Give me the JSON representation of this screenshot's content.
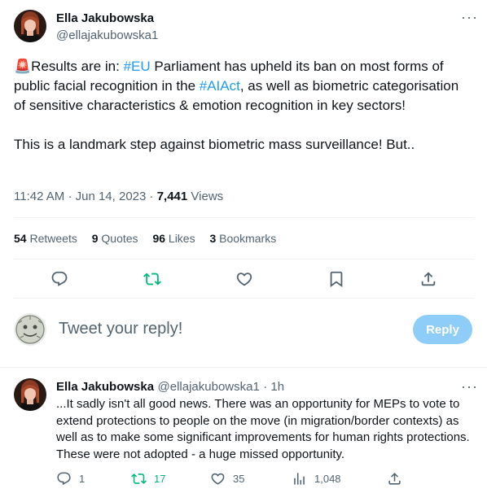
{
  "tweet": {
    "author_name": "Ella Jakubowska",
    "author_handle": "@ellajakubowska1",
    "text_parts": {
      "emoji": "🚨",
      "t1": "Results are in: ",
      "hashtag1": "#EU",
      "t2": " Parliament has upheld its ban on most forms of public facial recognition in the ",
      "hashtag2": "#AIAct",
      "t3": ", as well as biometric categorisation of sensitive characteristics & emotion recognition in key sectors!",
      "t4": "This is a landmark step against biometric mass surveillance! But.."
    },
    "time": "11:42 AM",
    "date": "Jun 14, 2023",
    "separator": "·",
    "views_count": "7,441",
    "views_label": "Views",
    "stats": {
      "retweets_count": "54",
      "retweets_label": "Retweets",
      "quotes_count": "9",
      "quotes_label": "Quotes",
      "likes_count": "96",
      "likes_label": "Likes",
      "bookmarks_count": "3",
      "bookmarks_label": "Bookmarks"
    },
    "more": "···"
  },
  "composer": {
    "placeholder": "Tweet your reply!",
    "reply_button": "Reply"
  },
  "reply": {
    "author_name": "Ella Jakubowska",
    "author_handle": "@ellajakubowska1",
    "time_ago": "· 1h",
    "text": "...It sadly isn't all good news. There was an opportunity for MEPs to vote to extend protections to people on the move (in migration/border contexts) as well as to make some significant improvements for human rights protections. These were not adopted - a huge missed opportunity.",
    "replies": "1",
    "retweets": "17",
    "likes": "35",
    "views": "1,048",
    "more": "···"
  },
  "colors": {
    "accent": "#1d9bf0",
    "retweet_green": "#00ba7c",
    "reply_button_bg": "#8ecdf8"
  }
}
